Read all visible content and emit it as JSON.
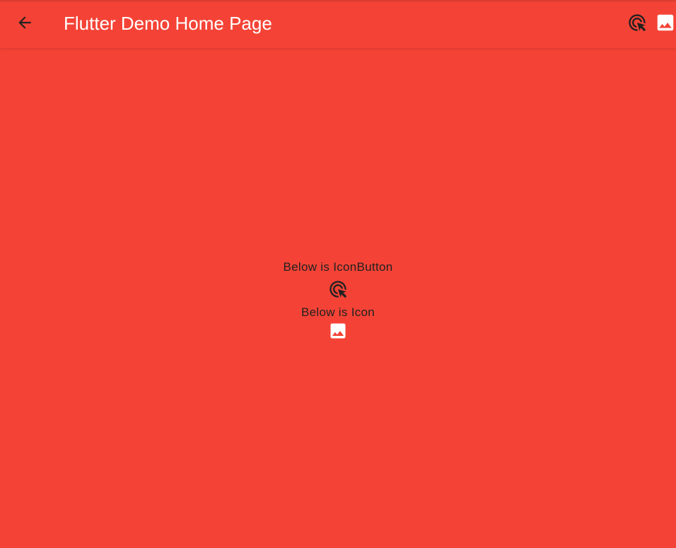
{
  "appbar": {
    "title": "Flutter Demo Home Page",
    "back_icon": "arrow-back-icon",
    "actions": [
      {
        "icon": "ads-click-icon"
      },
      {
        "icon": "image-icon"
      }
    ]
  },
  "body": {
    "icon_button_label": "Below is IconButton",
    "icon_button_icon": "ads-click-icon",
    "icon_label": "Below is Icon",
    "icon_icon": "image-icon"
  },
  "colors": {
    "background": "#F44336",
    "appbar_text": "#FFFFFF",
    "body_text": "#212121",
    "icon_dark": "#212121"
  }
}
